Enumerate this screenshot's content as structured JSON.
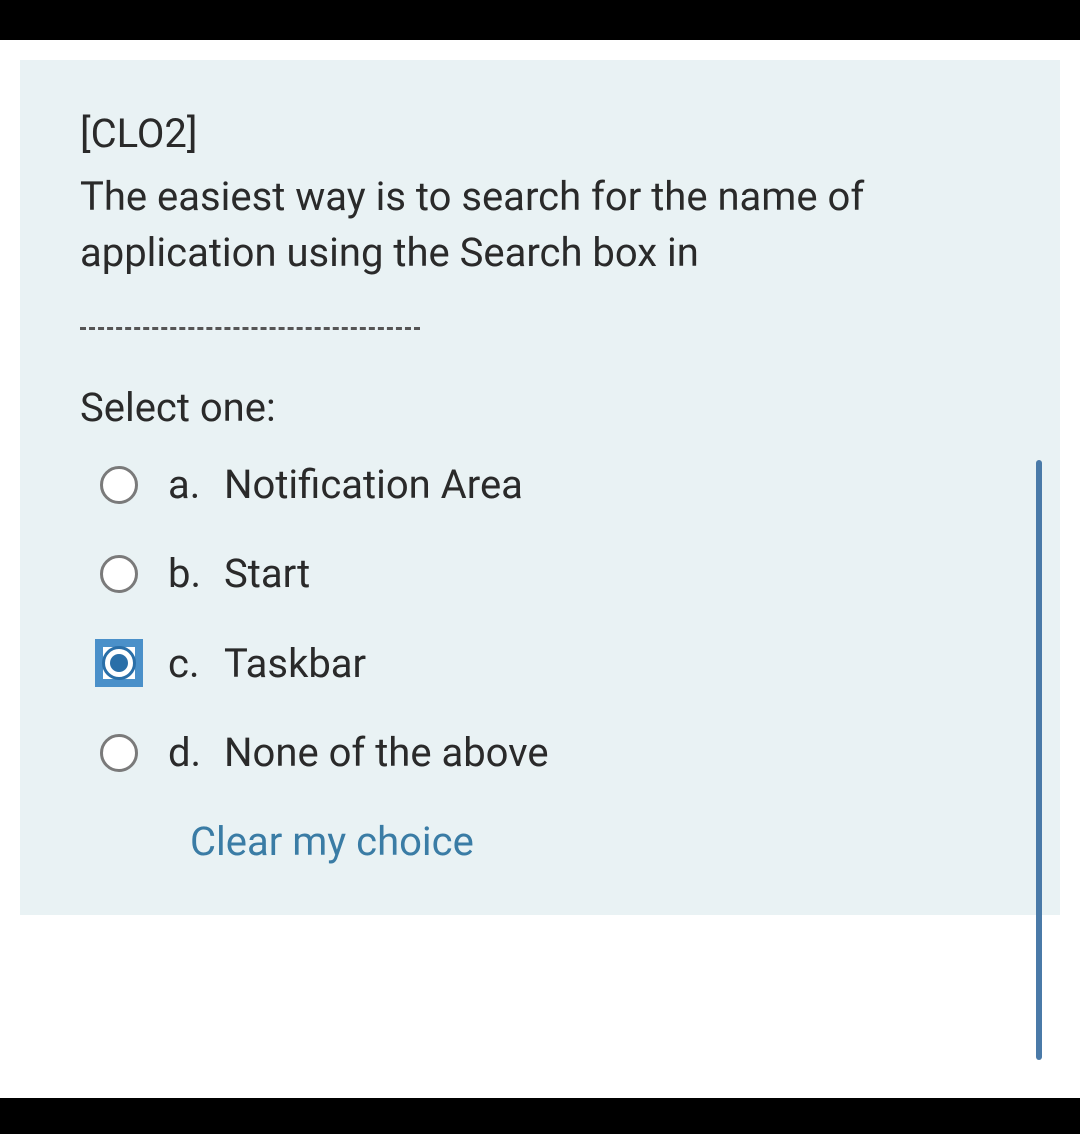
{
  "question": {
    "tag": "[CLO2]",
    "text": "The easiest way is to search for the name of application using the Search box in",
    "select_label": "Select one:",
    "options": [
      {
        "letter": "a.",
        "text": "Notification Area",
        "selected": false
      },
      {
        "letter": "b.",
        "text": "Start",
        "selected": false
      },
      {
        "letter": "c.",
        "text": "Taskbar",
        "selected": true
      },
      {
        "letter": "d.",
        "text": "None of the above",
        "selected": false
      }
    ],
    "clear_label": "Clear my choice"
  }
}
